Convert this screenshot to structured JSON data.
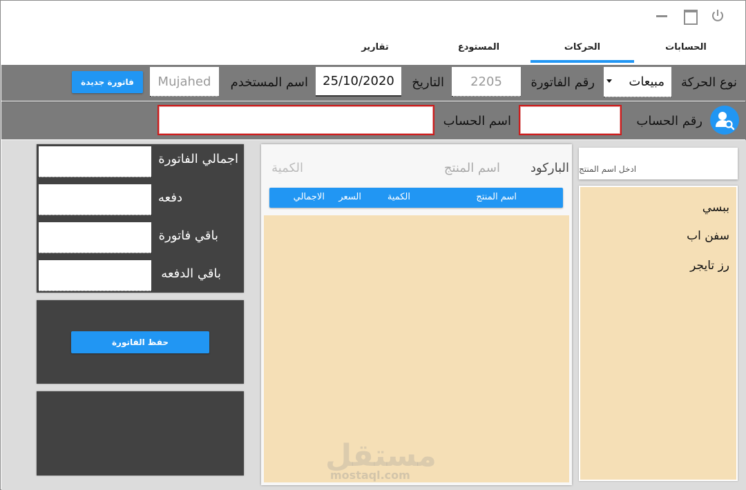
{
  "tabs": [
    {
      "label": "الحسابات"
    },
    {
      "label": "الحركات"
    },
    {
      "label": "المستودع"
    },
    {
      "label": "تقارير"
    }
  ],
  "header": {
    "movement_type_label": "نوع الحركة",
    "movement_type_value": "مبيعات",
    "invoice_number_label": "رقم الفاتورة",
    "invoice_number_value": "2205",
    "date_label": "التاريخ",
    "date_value": "25/10/2020",
    "username_label": "اسم المستخدم",
    "username_value": "Mujahed",
    "new_invoice_button": "فاتورة جديدة"
  },
  "account": {
    "number_label": "رقم الحساب",
    "number_value": "",
    "name_label": "اسم الحساب",
    "name_value": ""
  },
  "products": {
    "search_placeholder": "ادخل اسم المنتج",
    "items": [
      "ببسي",
      "سفن اب",
      "رز تايجر"
    ]
  },
  "entry": {
    "barcode_label": "الباركود",
    "product_name_label": "اسم المنتج",
    "quantity_label": "الكمية"
  },
  "table": {
    "columns": [
      "اسم المنتج",
      "الكمية",
      "السعر",
      "الاجمالي"
    ],
    "rows": []
  },
  "totals": {
    "invoice_total_label": "اجمالي الفاتورة",
    "payment_label": "دفعه",
    "invoice_remaining_label": "باقي فاتورة",
    "payment_remaining_label": "باقي الدفعه"
  },
  "save_button": "حفظ الفاتورة",
  "watermark": {
    "arabic": "مستقل",
    "latin": "mostaql.com"
  },
  "colors": {
    "accent": "#2196F3",
    "header_bar": "#7b7b7b",
    "panel_dark": "#424242",
    "list_bg": "#f5dfb6",
    "error_border": "#cc1b1b"
  }
}
